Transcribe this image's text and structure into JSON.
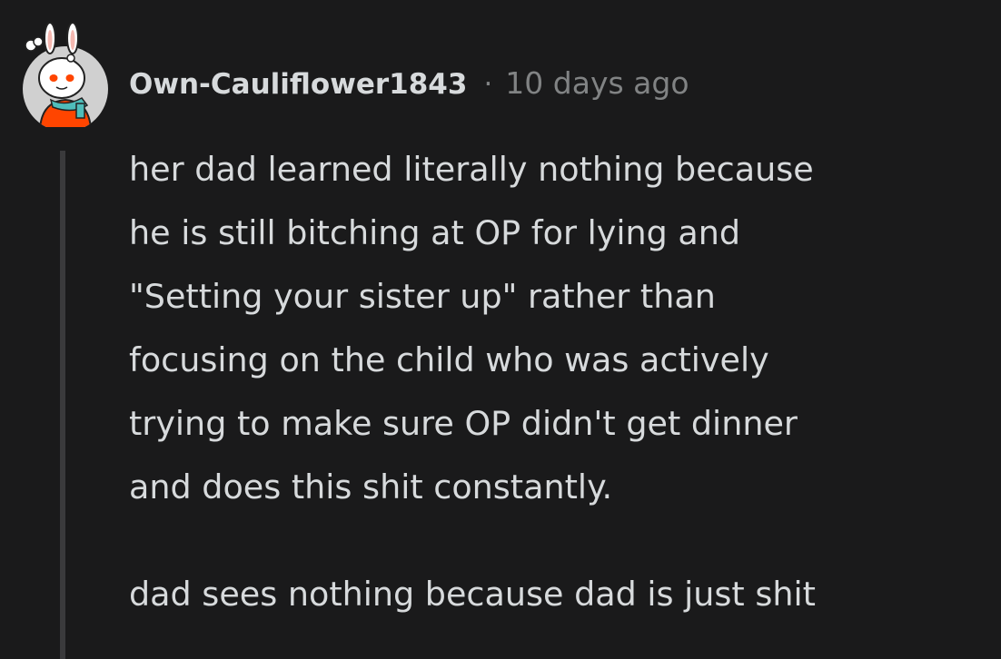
{
  "comment": {
    "author": "Own-Cauliflower1843",
    "separator": "·",
    "timestamp": "10 days ago",
    "avatar": "snoo-bunny-avatar-icon",
    "paragraphs": [
      {
        "lines": [
          "her dad learned literally nothing because",
          "he is still bitching at OP for lying and",
          "\"Setting your sister up\" rather than",
          "focusing on the child who was actively",
          "trying to make sure OP didn't get dinner",
          "and does this shit constantly."
        ]
      },
      {
        "lines": [
          "dad sees nothing because dad is just shit"
        ]
      }
    ]
  },
  "colors": {
    "background": "#1a1a1b",
    "text": "#d7dadc",
    "meta_text": "#818384",
    "thread_line": "#3a3a3c",
    "avatar_bg": "#d0d0d0",
    "avatar_shirt": "#ff4500",
    "avatar_scarf": "#4fbdba"
  }
}
